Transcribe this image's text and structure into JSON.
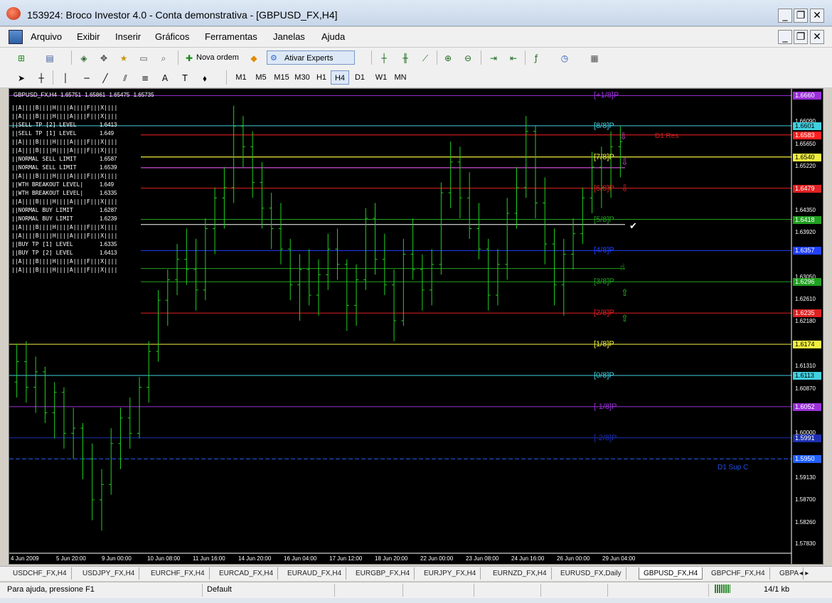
{
  "window": {
    "title": "153924: Broco Investor 4.0 - Conta demonstrativa - [GBPUSD_FX,H4]"
  },
  "menu": {
    "items": [
      "Arquivo",
      "Exibir",
      "Inserir",
      "Gráficos",
      "Ferramentas",
      "Janelas",
      "Ajuda"
    ]
  },
  "toolbar": {
    "new_order_label": "Nova ordem",
    "experts_label": "Ativar Experts"
  },
  "timeframes": [
    "M1",
    "M5",
    "M15",
    "M30",
    "H1",
    "H4",
    "D1",
    "W1",
    "MN"
  ],
  "active_timeframe": "H4",
  "chart_header": {
    "symbol": "GBPUSD_FX,H4",
    "open": "1.65751",
    "high": "1.65861",
    "low": "1.65475",
    "close": "1.65735"
  },
  "info_panel": [
    {
      "label": "||A||||B||||H||||A||||F|||X||||",
      "value": ""
    },
    {
      "label": "||A||||B||||H||||A||||F|||X||||",
      "value": ""
    },
    {
      "label": "||SELL TP [2] LEVEL",
      "value": "1.6413"
    },
    {
      "label": "||SELL TP [1] LEVEL",
      "value": "1.649"
    },
    {
      "label": "||A||||B||||H||||A||||F|||X||||",
      "value": ""
    },
    {
      "label": "||A||||B||||H||||A||||F|||X||||",
      "value": ""
    },
    {
      "label": "||NORMAL SELL LIMIT",
      "value": "1.6587"
    },
    {
      "label": "||NORMAL SELL LIMIT",
      "value": "1.6539"
    },
    {
      "label": "||A||||B||||H||||A||||F|||X||||",
      "value": ""
    },
    {
      "label": "||WTH BREAKOUT LEVEL|",
      "value": "1.649"
    },
    {
      "label": "||WTH BREAKOUT LEVEL|",
      "value": "1.6335"
    },
    {
      "label": "||A||||B||||H||||A||||F|||X||||",
      "value": ""
    },
    {
      "label": "||NORMAL BUY LIMIT",
      "value": "1.6287"
    },
    {
      "label": "||NORMAL BUY LIMIT",
      "value": "1.6239"
    },
    {
      "label": "||A||||B||||H||||A||||F|||X||||",
      "value": ""
    },
    {
      "label": "||A||||B||||H||||A||||F|||X||||",
      "value": ""
    },
    {
      "label": "||BUY TP [1] LEVEL",
      "value": "1.6335"
    },
    {
      "label": "||BUY TP [2] LEVEL",
      "value": "1.6413"
    },
    {
      "label": "||A||||B||||H||||A||||F|||X||||",
      "value": ""
    },
    {
      "label": "||A||||B||||H||||A||||F|||X||||",
      "value": ""
    }
  ],
  "price_axis": [
    "1.66090",
    "1.65650",
    "1.65220",
    "1.64350",
    "1.63920",
    "1.63050",
    "1.62610",
    "1.62180",
    "1.61310",
    "1.60870",
    "1.60000",
    "1.59130",
    "1.58700",
    "1.58260",
    "1.57830"
  ],
  "levels": [
    {
      "label": "[+1/8]P",
      "price": "1.6660",
      "color": "#9b30d9"
    },
    {
      "label": "[8/8]P",
      "price": "1.6601",
      "color": "#40d0e0"
    },
    {
      "label": "",
      "price": "1.6583",
      "color": "#ff2020"
    },
    {
      "label": "[7/8]P",
      "price": "1.6540",
      "color": "#f0f040"
    },
    {
      "label": "[6/8]P",
      "price": "1.6479",
      "color": "#e02020"
    },
    {
      "label": "[5/8]P",
      "price": "1.6418",
      "color": "#20a020"
    },
    {
      "label": "[4/8]P",
      "price": "1.6357",
      "color": "#2040ff"
    },
    {
      "label": "[3/8]P",
      "price": "1.6296",
      "color": "#20a020"
    },
    {
      "label": "[2/8]P",
      "price": "1.6235",
      "color": "#e02020"
    },
    {
      "label": "[1/8]P",
      "price": "1.6174",
      "color": "#f0f040"
    },
    {
      "label": "[0/8]P",
      "price": "1.6113",
      "color": "#40d0e0"
    },
    {
      "label": "[-1/8]P",
      "price": "1.6052",
      "color": "#9b30d9"
    },
    {
      "label": "[-2/8]P",
      "price": "1.5991",
      "color": "#1c2fb0"
    },
    {
      "label": "",
      "price": "1.5950",
      "color": "#2060ff"
    }
  ],
  "annotations": {
    "d1_res": "D1 Res",
    "d1_sup": "D1 Sup C"
  },
  "x_axis": [
    "4 Jun 2009",
    "5 Jun 20:00",
    "9 Jun 00:00",
    "10 Jun 08:00",
    "11 Jun 16:00",
    "14 Jun 20:00",
    "16 Jun 04:00",
    "17 Jun 12:00",
    "18 Jun 20:00",
    "22 Jun 00:00",
    "23 Jun 08:00",
    "24 Jun 16:00",
    "26 Jun 00:00",
    "29 Jun 04:00"
  ],
  "chart_data": {
    "type": "ohlc",
    "title": "GBPUSD_FX,H4",
    "ylim": [
      1.5767,
      1.6673
    ],
    "colors": {
      "bars": "#20d020",
      "background": "#000000"
    },
    "bars": [
      [
        1.61,
        1.6175,
        1.607,
        1.614
      ],
      [
        1.614,
        1.618,
        1.606,
        1.609
      ],
      [
        1.609,
        1.615,
        1.604,
        1.612
      ],
      [
        1.612,
        1.613,
        1.602,
        1.604
      ],
      [
        1.604,
        1.61,
        1.599,
        1.608
      ],
      [
        1.608,
        1.609,
        1.597,
        1.6
      ],
      [
        1.6,
        1.605,
        1.595,
        1.601
      ],
      [
        1.601,
        1.602,
        1.591,
        1.595
      ],
      [
        1.595,
        1.598,
        1.583,
        1.587
      ],
      [
        1.587,
        1.593,
        1.581,
        1.59
      ],
      [
        1.59,
        1.601,
        1.588,
        1.598
      ],
      [
        1.598,
        1.605,
        1.593,
        1.603
      ],
      [
        1.603,
        1.607,
        1.597,
        1.6
      ],
      [
        1.6,
        1.611,
        1.599,
        1.609
      ],
      [
        1.609,
        1.618,
        1.606,
        1.616
      ],
      [
        1.616,
        1.628,
        1.614,
        1.626
      ],
      [
        1.626,
        1.632,
        1.621,
        1.63
      ],
      [
        1.63,
        1.637,
        1.627,
        1.634
      ],
      [
        1.634,
        1.64,
        1.629,
        1.632
      ],
      [
        1.632,
        1.638,
        1.624,
        1.628
      ],
      [
        1.628,
        1.642,
        1.626,
        1.64
      ],
      [
        1.64,
        1.648,
        1.635,
        1.646
      ],
      [
        1.646,
        1.652,
        1.64,
        1.648
      ],
      [
        1.648,
        1.664,
        1.645,
        1.66
      ],
      [
        1.66,
        1.662,
        1.652,
        1.656
      ],
      [
        1.656,
        1.659,
        1.646,
        1.649
      ],
      [
        1.649,
        1.653,
        1.64,
        1.644
      ],
      [
        1.644,
        1.647,
        1.636,
        1.64
      ],
      [
        1.64,
        1.645,
        1.633,
        1.636
      ],
      [
        1.636,
        1.638,
        1.626,
        1.629
      ],
      [
        1.629,
        1.635,
        1.622,
        1.632
      ],
      [
        1.632,
        1.636,
        1.625,
        1.627
      ],
      [
        1.627,
        1.634,
        1.623,
        1.631
      ],
      [
        1.631,
        1.639,
        1.628,
        1.636
      ],
      [
        1.636,
        1.64,
        1.63,
        1.633
      ],
      [
        1.633,
        1.634,
        1.62,
        1.625
      ],
      [
        1.625,
        1.633,
        1.621,
        1.63
      ],
      [
        1.63,
        1.644,
        1.628,
        1.642
      ],
      [
        1.642,
        1.645,
        1.631,
        1.634
      ],
      [
        1.634,
        1.639,
        1.627,
        1.629
      ],
      [
        1.629,
        1.632,
        1.618,
        1.622
      ],
      [
        1.622,
        1.638,
        1.621,
        1.635
      ],
      [
        1.635,
        1.642,
        1.63,
        1.632
      ],
      [
        1.632,
        1.635,
        1.624,
        1.628
      ],
      [
        1.628,
        1.636,
        1.625,
        1.633
      ],
      [
        1.633,
        1.649,
        1.631,
        1.647
      ],
      [
        1.647,
        1.657,
        1.644,
        1.653
      ],
      [
        1.653,
        1.656,
        1.642,
        1.646
      ],
      [
        1.646,
        1.651,
        1.638,
        1.64
      ],
      [
        1.64,
        1.645,
        1.634,
        1.636
      ],
      [
        1.636,
        1.638,
        1.624,
        1.627
      ],
      [
        1.627,
        1.636,
        1.625,
        1.633
      ],
      [
        1.633,
        1.646,
        1.63,
        1.643
      ],
      [
        1.643,
        1.652,
        1.64,
        1.648
      ],
      [
        1.648,
        1.662,
        1.646,
        1.659
      ],
      [
        1.659,
        1.66,
        1.642,
        1.645
      ],
      [
        1.645,
        1.65,
        1.633,
        1.637
      ],
      [
        1.637,
        1.64,
        1.625,
        1.629
      ],
      [
        1.629,
        1.638,
        1.623,
        1.635
      ],
      [
        1.635,
        1.642,
        1.632,
        1.639
      ],
      [
        1.639,
        1.648,
        1.637,
        1.646
      ],
      [
        1.646,
        1.655,
        1.643,
        1.652
      ],
      [
        1.652,
        1.656,
        1.644,
        1.648
      ],
      [
        1.648,
        1.659,
        1.646,
        1.656
      ],
      [
        1.656,
        1.66,
        1.65,
        1.657
      ]
    ]
  },
  "tabs": {
    "items": [
      "USDCHF_FX,H4",
      "USDJPY_FX,H4",
      "EURCHF_FX,H4",
      "EURCAD_FX,H4",
      "EURAUD_FX,H4",
      "EURGBP_FX,H4",
      "EURJPY_FX,H4",
      "EURNZD_FX,H4",
      "EURUSD_FX,Daily",
      "GBPUSD_FX,H4",
      "GBPCHF_FX,H4",
      "GBPA"
    ],
    "active": "GBPUSD_FX,H4"
  },
  "status": {
    "help": "Para ajuda, pressione F1",
    "profile": "Default",
    "traffic": "14/1 kb"
  }
}
